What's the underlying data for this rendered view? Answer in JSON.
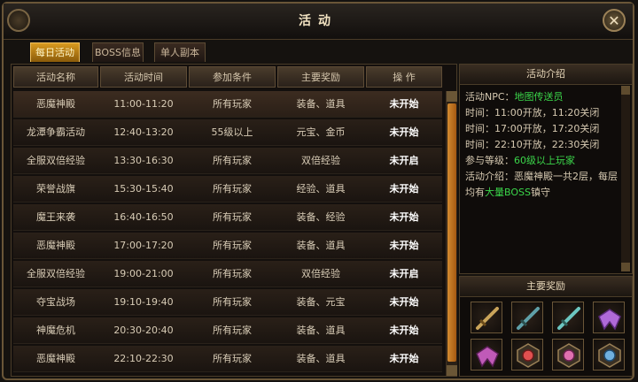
{
  "window": {
    "title": "活动"
  },
  "tabs": [
    {
      "label": "每日活动",
      "active": true
    },
    {
      "label": "BOSS信息",
      "active": false
    },
    {
      "label": "单人副本",
      "active": false
    }
  ],
  "table": {
    "headers": [
      "活动名称",
      "活动时间",
      "参加条件",
      "主要奖励",
      "操 作"
    ],
    "rows": [
      [
        "恶魔神殿",
        "11:00-11:20",
        "所有玩家",
        "装备、道具",
        "未开始"
      ],
      [
        "龙潭争霸活动",
        "12:40-13:20",
        "55级以上",
        "元宝、金币",
        "未开始"
      ],
      [
        "全服双倍经验",
        "13:30-16:30",
        "所有玩家",
        "双倍经验",
        "未开启"
      ],
      [
        "荣誉战旗",
        "15:30-15:40",
        "所有玩家",
        "经验、道具",
        "未开始"
      ],
      [
        "魔王来袭",
        "16:40-16:50",
        "所有玩家",
        "装备、经验",
        "未开始"
      ],
      [
        "恶魔神殿",
        "17:00-17:20",
        "所有玩家",
        "装备、道具",
        "未开始"
      ],
      [
        "全服双倍经验",
        "19:00-21:00",
        "所有玩家",
        "双倍经验",
        "未开启"
      ],
      [
        "夺宝战场",
        "19:10-19:40",
        "所有玩家",
        "装备、元宝",
        "未开始"
      ],
      [
        "神魔危机",
        "20:30-20:40",
        "所有玩家",
        "装备、道具",
        "未开始"
      ],
      [
        "恶魔神殿",
        "22:10-22:30",
        "所有玩家",
        "装备、道具",
        "未开始"
      ]
    ]
  },
  "intro": {
    "title": "活动介绍",
    "npc_label": "活动NPC：",
    "npc_value": "地图传送员",
    "time1": "时间：11:00开放，11:20关闭",
    "time2": "时间：17:00开放，17:20关闭",
    "time3": "时间：22:10开放，22:30关闭",
    "level_label": "参与等级：",
    "level_value": "60级以上玩家",
    "desc1": "活动介绍：恶魔神殿一共2层，每层",
    "desc2_a": "均有",
    "desc2_b": "大量BOSS",
    "desc2_c": "镇守"
  },
  "rewards": {
    "title": "主要奖励",
    "items": [
      "sword-icon",
      "axe-icon",
      "blade-icon",
      "wings-icon",
      "purple-wings-icon",
      "red-gem-icon",
      "pink-gem-icon",
      "blue-gem-icon"
    ]
  },
  "colors": {
    "accent": "#d89a20",
    "highlight": "#3bd64a",
    "text": "#d8ccb6"
  }
}
